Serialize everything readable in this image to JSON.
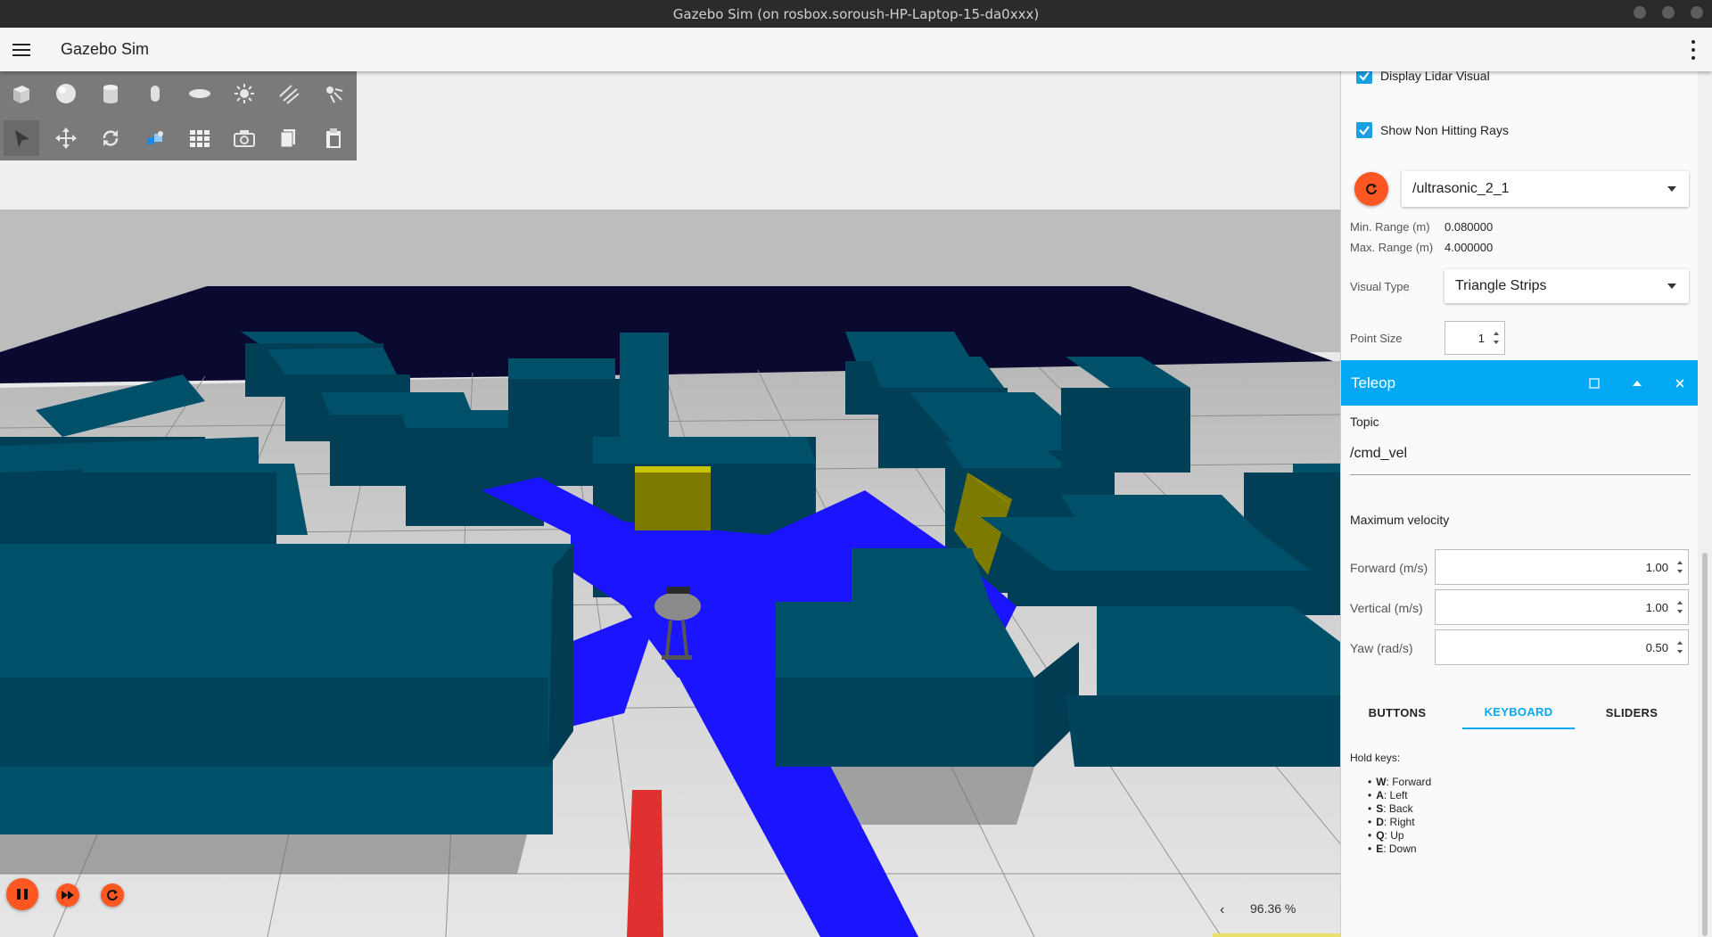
{
  "window": {
    "title": "Gazebo Sim (on rosbox.soroush-HP-Laptop-15-da0xxx)"
  },
  "appbar": {
    "title": "Gazebo Sim",
    "menu_icon": "hamburger-menu-icon",
    "more_icon": "more-vert-icon"
  },
  "toolbar": {
    "shapes": [
      "box",
      "sphere",
      "cylinder",
      "capsule",
      "ellipsoid",
      "directional-light",
      "spot-light",
      "point-light"
    ],
    "tools": [
      "select",
      "translate",
      "rotate",
      "transform-control",
      "grid",
      "screenshot",
      "copy",
      "paste"
    ]
  },
  "playback": {
    "play_icon": "pause-icon",
    "step_icon": "fast-forward-icon",
    "reset_icon": "reset-icon",
    "real_time_factor": "96.36 %",
    "collapse_icon": "chevron-left-icon"
  },
  "lidar": {
    "display_lidar_visual_label": "Display Lidar Visual",
    "display_lidar_visual": true,
    "show_non_hitting_rays_label": "Show Non Hitting Rays",
    "show_non_hitting_rays": true,
    "topic": "/ultrasonic_2_1",
    "min_range_label": "Min. Range (m)",
    "min_range": "0.080000",
    "max_range_label": "Max. Range (m)",
    "max_range": "4.000000",
    "visual_type_label": "Visual Type",
    "visual_type": "Triangle Strips",
    "point_size_label": "Point Size",
    "point_size": "1"
  },
  "teleop": {
    "title": "Teleop",
    "topic_label": "Topic",
    "topic": "/cmd_vel",
    "max_velocity_label": "Maximum velocity",
    "forward_label": "Forward (m/s)",
    "forward": "1.00",
    "vertical_label": "Vertical (m/s)",
    "vertical": "1.00",
    "yaw_label": "Yaw (rad/s)",
    "yaw": "0.50",
    "tabs": [
      "BUTTONS",
      "KEYBOARD",
      "SLIDERS"
    ],
    "active_tab": "KEYBOARD",
    "hold_keys_label": "Hold keys:",
    "keys": [
      {
        "key": "W",
        "action": ": Forward"
      },
      {
        "key": "A",
        "action": ": Left"
      },
      {
        "key": "S",
        "action": ": Back"
      },
      {
        "key": "D",
        "action": ": Right"
      },
      {
        "key": "Q",
        "action": ": Up"
      },
      {
        "key": "E",
        "action": ": Down"
      }
    ]
  },
  "colors": {
    "accent": "#03a9f4",
    "play_buttons": "#ff5722",
    "wall": "#00506a",
    "laser": "#1a14ff",
    "marker_red": "#e03030",
    "door_yellow": "#b8a80a",
    "sky": "#0a0a30"
  }
}
